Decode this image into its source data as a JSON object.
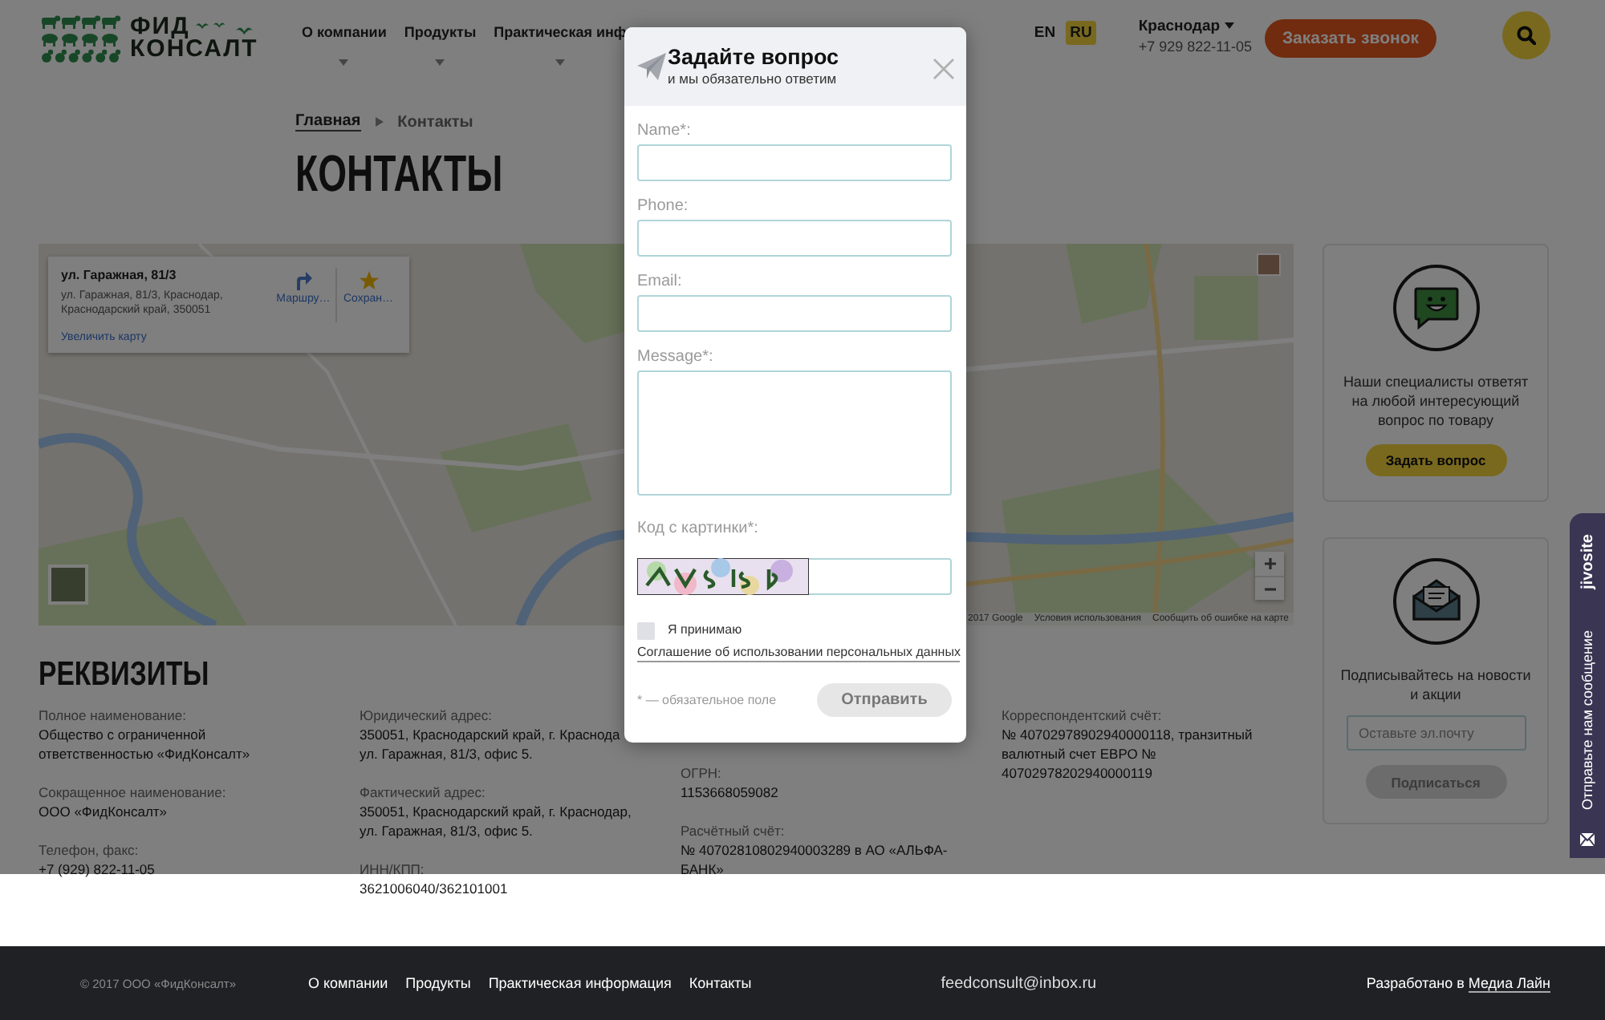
{
  "header": {
    "logo": {
      "line_1": "ФИД",
      "line_2": "КОНСАЛТ"
    },
    "nav": [
      {
        "label": "О компании"
      },
      {
        "label": "Продукты"
      },
      {
        "label": "Практическая инф"
      }
    ],
    "languages": [
      {
        "label": "EN",
        "selected": false
      },
      {
        "label": "RU",
        "selected": true
      }
    ],
    "city": "Краснодар",
    "phone": "+7 929 822-11-05",
    "callback_button": "Заказать звонок"
  },
  "breadcrumbs": [
    {
      "label": "Главная",
      "kind": "link"
    },
    {
      "label": "Контакты",
      "kind": "current"
    }
  ],
  "title": "КОНТАКТЫ",
  "map": {
    "place_card": {
      "title": "ул. Гаражная, 81/3",
      "address_lines": [
        "ул. Гаражная, 81/3, Краснодар,",
        "Краснодарский край, 350051"
      ],
      "link": "Увеличить карту",
      "actions": [
        {
          "kind": "directions",
          "label": "Маршру…"
        },
        {
          "kind": "save",
          "label": "Сохран…"
        }
      ]
    },
    "attribution": [
      "2017 Google",
      "Условия использования",
      "Сообщить об ошибке на карте"
    ]
  },
  "sidebar": {
    "cards": [
      {
        "kind": "question",
        "text": "Наши специалисты ответят на любой интересующий вопрос по товару",
        "button": "Задать вопрос"
      },
      {
        "kind": "subscribe",
        "text": "Подписывайтесь на новости и акции",
        "placeholder": "Оставьте эл.почту",
        "button": "Подписаться"
      }
    ]
  },
  "requisites": {
    "title": "РЕКВИЗИТЫ",
    "columns": [
      [
        {
          "label": "Полное наименование:",
          "lines": [
            "Общество с ограниченной",
            "ответственностью «ФидКонсалт»"
          ]
        },
        {
          "label": "Сокращенное наименование:",
          "lines": [
            "ООО «ФидКонсалт»"
          ]
        },
        {
          "label": "Телефон, факс:",
          "lines": [
            "+7 (929) 822-11-05"
          ]
        }
      ],
      [
        {
          "label": "Юридический адрес:",
          "lines": [
            "350051, Краснодарский край, г. Краснода",
            "ул. Гаражная, 81/3, офис 5."
          ]
        },
        {
          "label": "Фактический адрес:",
          "lines": [
            "350051, Краснодарский край, г. Краснодар,",
            "ул. Гаражная, 81/3, офис 5."
          ]
        },
        {
          "label": "ИНН/КПП:",
          "lines": [
            "3621006040/362101001"
          ]
        }
      ],
      [
        {
          "label": "ОГРН:",
          "lines": [
            "1153668059082"
          ]
        },
        {
          "label": "Расчётный счёт:",
          "lines": [
            "№ 40702810802940003289 в АО «АЛЬФА-",
            "БАНК»"
          ]
        }
      ],
      [
        {
          "label": "Корреспондентский счёт:",
          "lines": [
            "№ 40702978902940000118, транзитный",
            "валютный счет ЕВРО №",
            "40702978202940000119"
          ]
        }
      ]
    ]
  },
  "modal": {
    "title": "Задайте вопрос",
    "subtitle": "и мы обязательно ответим",
    "fields": [
      {
        "kind": "input",
        "label": "Name*:"
      },
      {
        "kind": "input",
        "label": "Phone:"
      },
      {
        "kind": "input",
        "label": "Email:"
      },
      {
        "kind": "textarea",
        "label": "Message*:"
      },
      {
        "kind": "captcha",
        "label": "Код с картинки*:"
      }
    ],
    "consent": {
      "checked": false,
      "text": "Я принимаю",
      "link": "Соглашение об использовании персональных данных"
    },
    "required_note": "* — обязательное поле",
    "submit_button": "Отправить"
  },
  "chat_widget": {
    "brand": "jivosite",
    "label": "Отправьте нам сообщение"
  },
  "footer": {
    "copyright": "© 2017 ООО «ФидКонсалт»",
    "nav": [
      "О компании",
      "Продукты",
      "Практическая информация",
      "Контакты"
    ],
    "email": "feedconsult@inbox.ru",
    "credit": {
      "text": "Разработано в",
      "link": "Медиа Лайн"
    }
  }
}
